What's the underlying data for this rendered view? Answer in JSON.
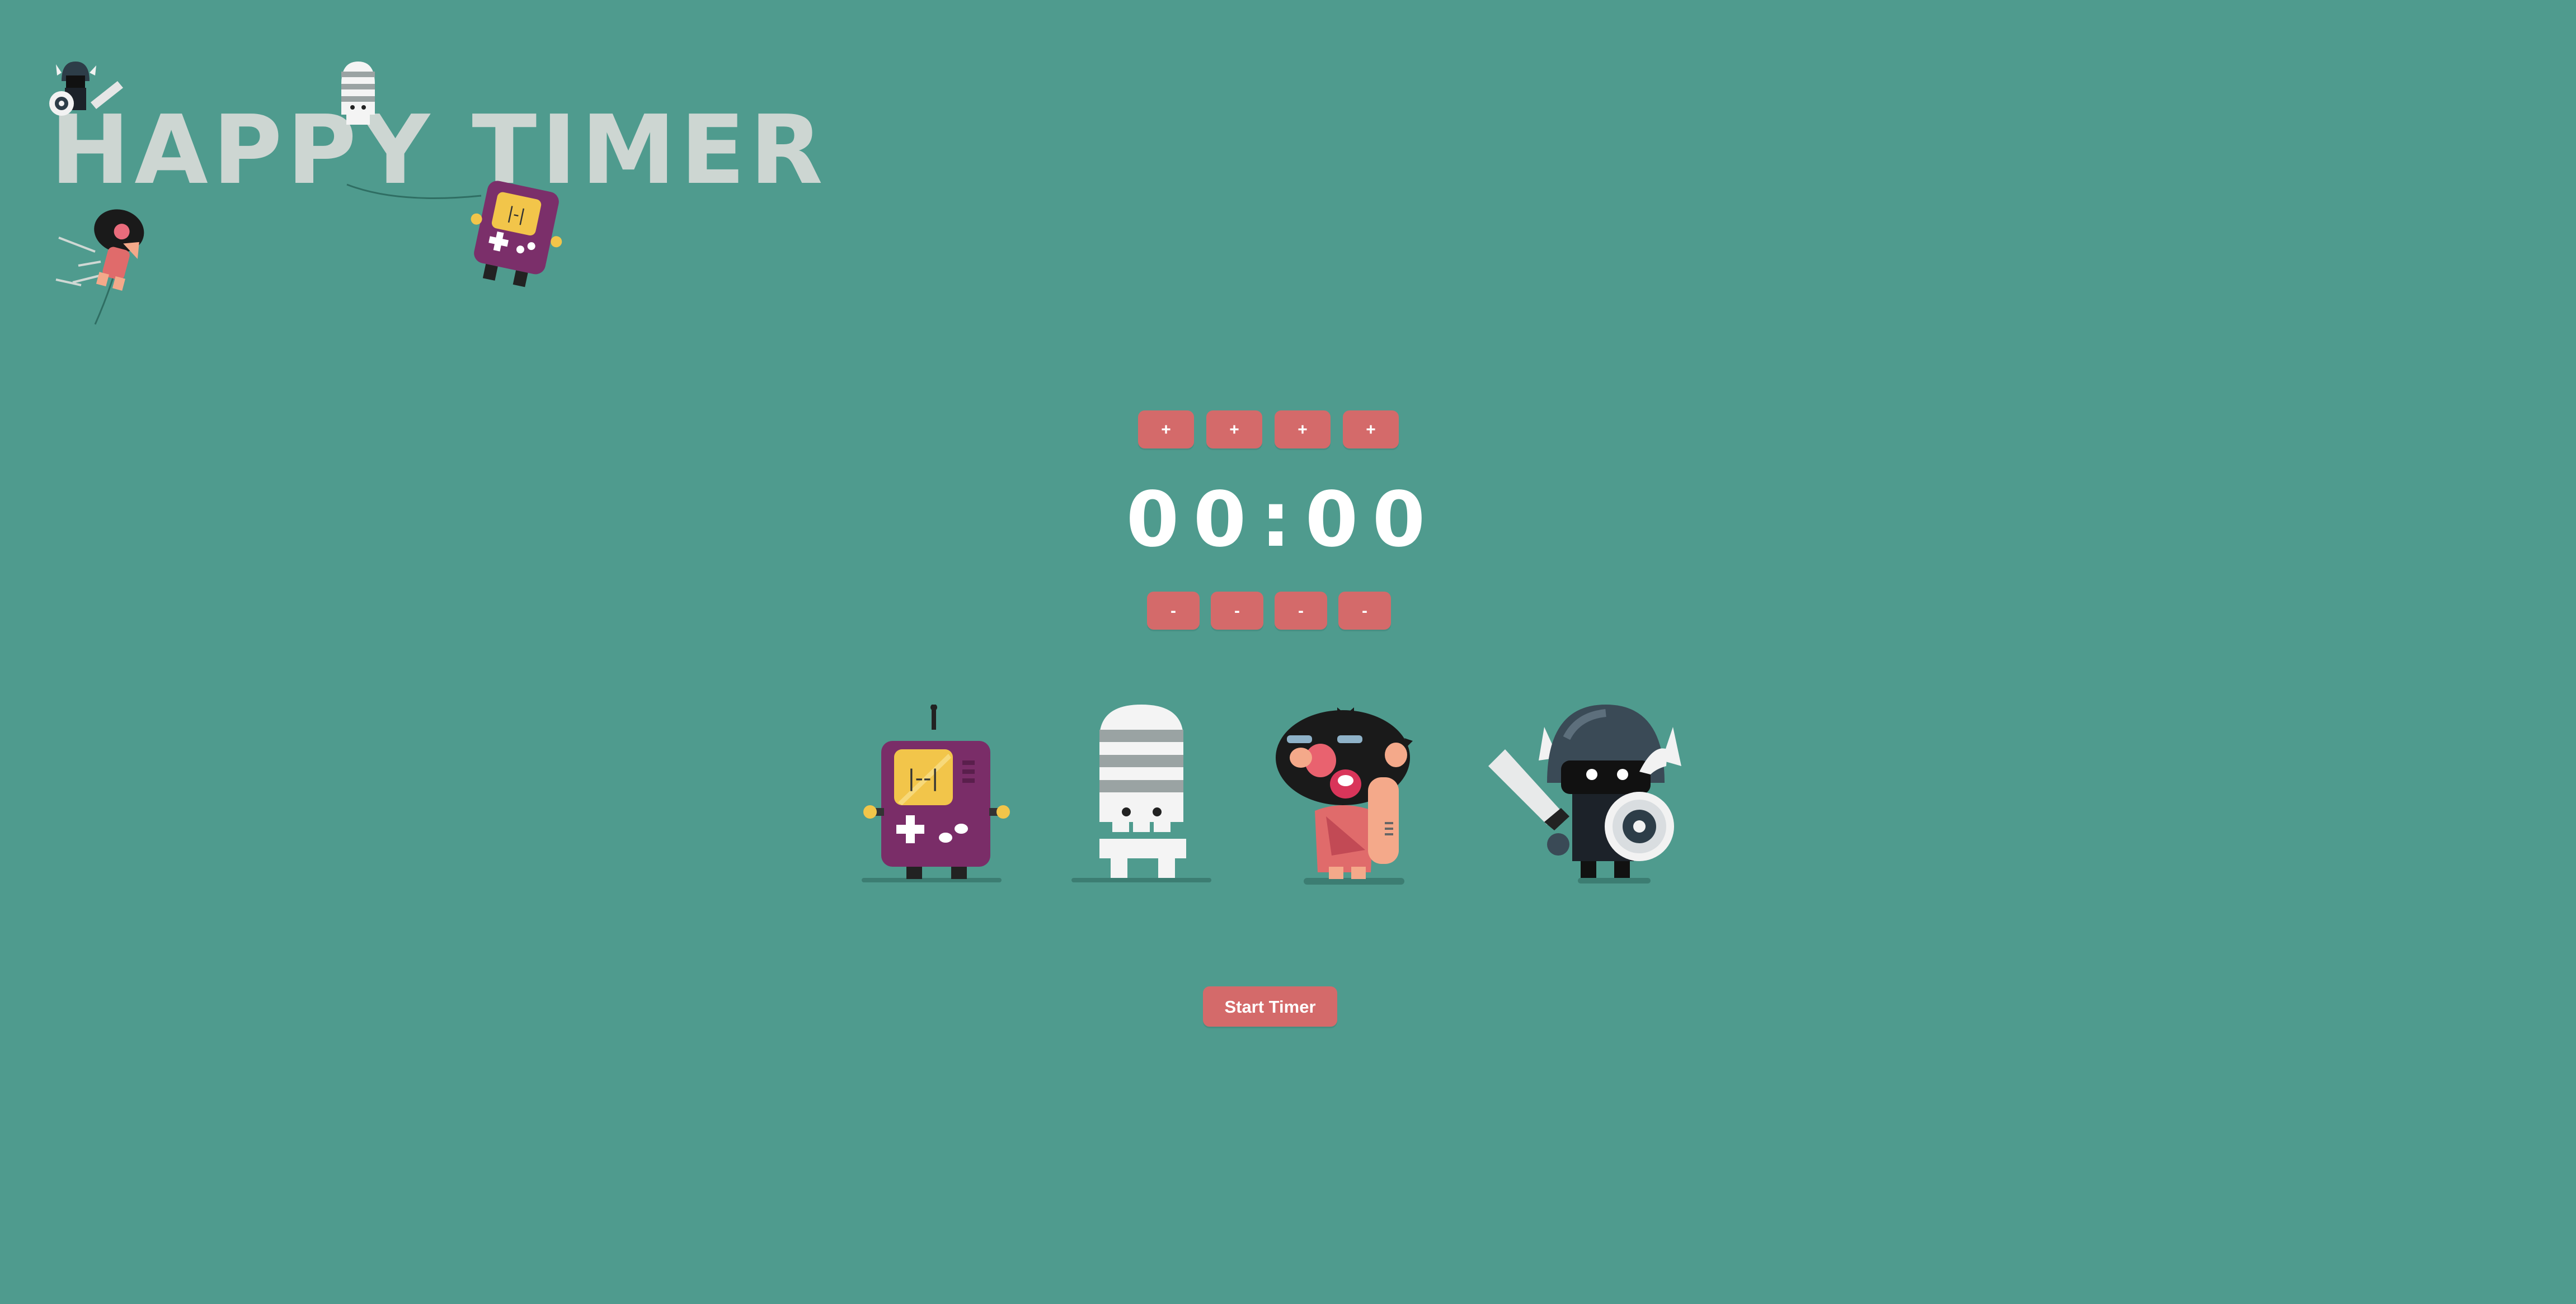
{
  "app": {
    "title": "HAPPY TIMER"
  },
  "timer": {
    "increment_labels": [
      "+",
      "+",
      "+",
      "+"
    ],
    "decrement_labels": [
      "-",
      "-",
      "-",
      "-"
    ],
    "digits": [
      "0",
      "0",
      "0",
      "0"
    ],
    "separator": ":",
    "start_label": "Start Timer"
  },
  "characters": [
    "game-console",
    "skeleton",
    "caveman",
    "knight"
  ],
  "colors": {
    "background": "#4f9b8e",
    "button": "#d46a6a",
    "digits": "#ffffff",
    "logo_text": "#cdd6d2"
  }
}
